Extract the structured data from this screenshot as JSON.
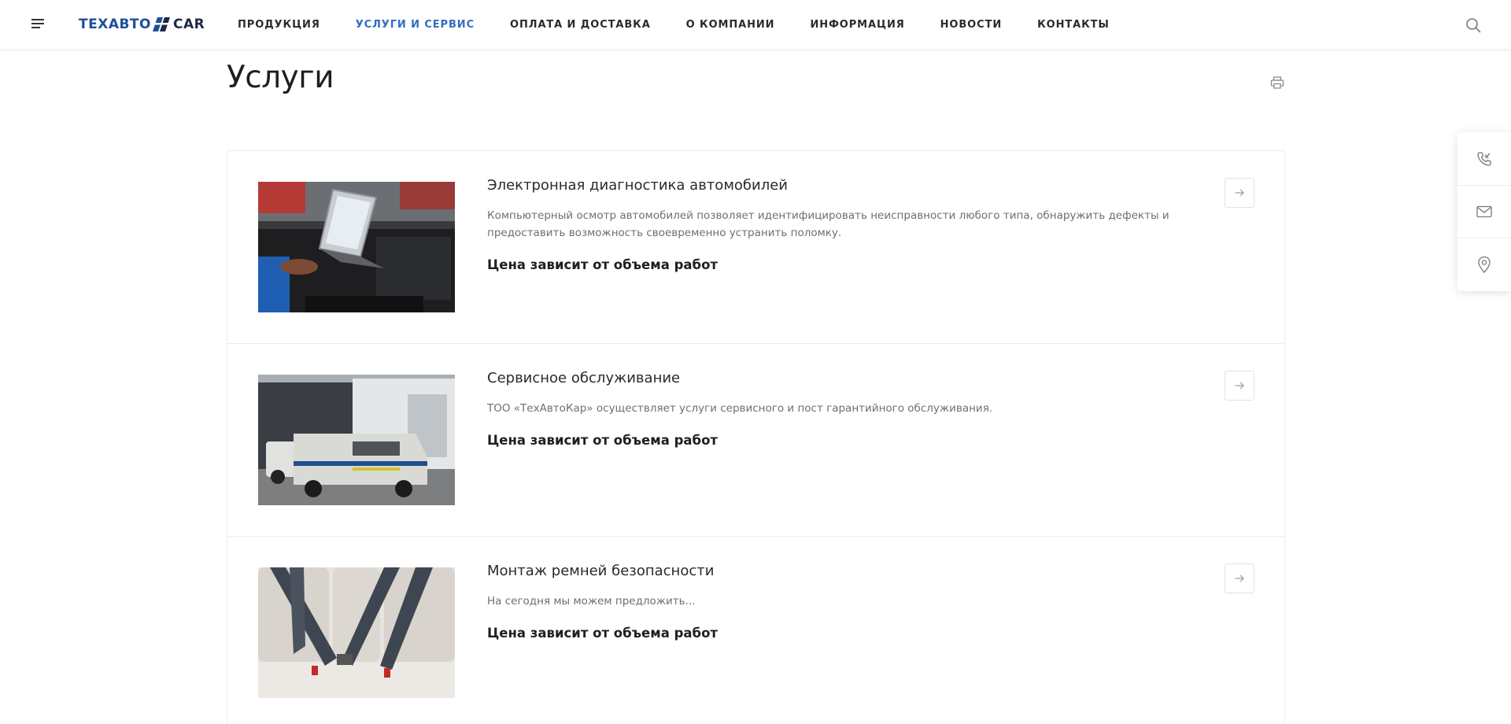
{
  "header": {
    "logo": {
      "part_a": "ТЕХАВТО",
      "part_b": "CAR",
      "colors": {
        "primary": "#1d4f9b",
        "dark": "#1c2a44"
      }
    },
    "nav": [
      {
        "label": "ПРОДУКЦИЯ",
        "active": false
      },
      {
        "label": "УСЛУГИ И СЕРВИС",
        "active": true
      },
      {
        "label": "ОПЛАТА И ДОСТАВКА",
        "active": false
      },
      {
        "label": "О КОМПАНИИ",
        "active": false
      },
      {
        "label": "ИНФОРМАЦИЯ",
        "active": false
      },
      {
        "label": "НОВОСТИ",
        "active": false
      },
      {
        "label": "КОНТАКТЫ",
        "active": false
      }
    ],
    "icons": {
      "menu": "hamburger-menu-icon",
      "search": "search-icon"
    },
    "accent_color": "#2f6dc4"
  },
  "page": {
    "title": "Услуги",
    "print_icon": "print-icon"
  },
  "services": [
    {
      "title": "Электронная диагностика автомобилей",
      "description": "Компьютерный осмотр автомобилей позволяет идентифицировать неисправности любого типа, обнаружить дефекты и предоставить возможность своевременно устранить поломку.",
      "price": "Цена зависит от объема работ",
      "image": "laptop-engine-diagnostics-photo"
    },
    {
      "title": "Сервисное обслуживание",
      "description": "ТОО «ТехАвтоКар» осуществляет услуги сервисного и пост гарантийного обслуживания.",
      "price": "Цена зависит от объема работ",
      "image": "service-vans-building-photo"
    },
    {
      "title": "Монтаж ремней безопасности",
      "description": "На сегодня мы можем предложить...",
      "price": "Цена зависит от объема работ",
      "image": "seat-belts-photo"
    }
  ],
  "side_panel": [
    {
      "icon": "phone-callback-icon"
    },
    {
      "icon": "mail-icon"
    },
    {
      "icon": "location-pin-icon"
    }
  ]
}
